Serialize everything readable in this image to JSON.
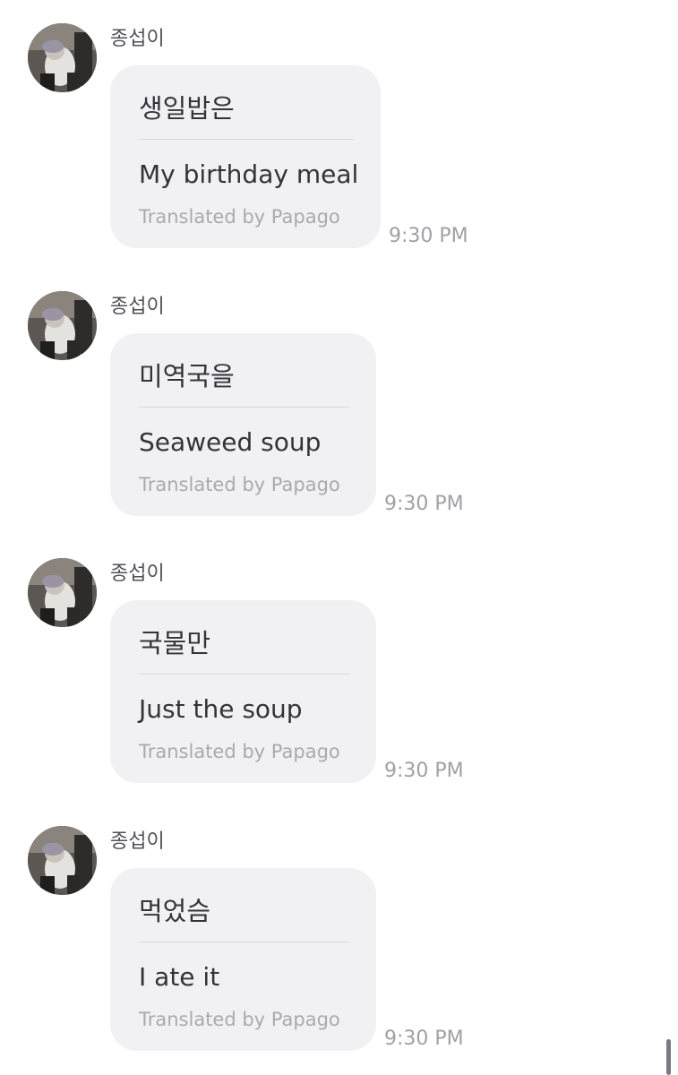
{
  "messages": [
    {
      "sender": "종섭이",
      "original": "생일밥은",
      "translation": "My birthday meal",
      "credit": "Translated by Papago",
      "time": "9:30 PM"
    },
    {
      "sender": "종섭이",
      "original": "미역국을",
      "translation": "Seaweed soup",
      "credit": "Translated by Papago",
      "time": "9:30 PM"
    },
    {
      "sender": "종섭이",
      "original": "국물만",
      "translation": "Just the soup",
      "credit": "Translated by Papago",
      "time": "9:30 PM"
    },
    {
      "sender": "종섭이",
      "original": "먹었슴",
      "translation": "I ate it",
      "credit": "Translated by Papago",
      "time": "9:30 PM"
    }
  ],
  "colors": {
    "bubble": "#f1f1f4",
    "text": "#33333a",
    "muted": "#a9a9b0"
  }
}
